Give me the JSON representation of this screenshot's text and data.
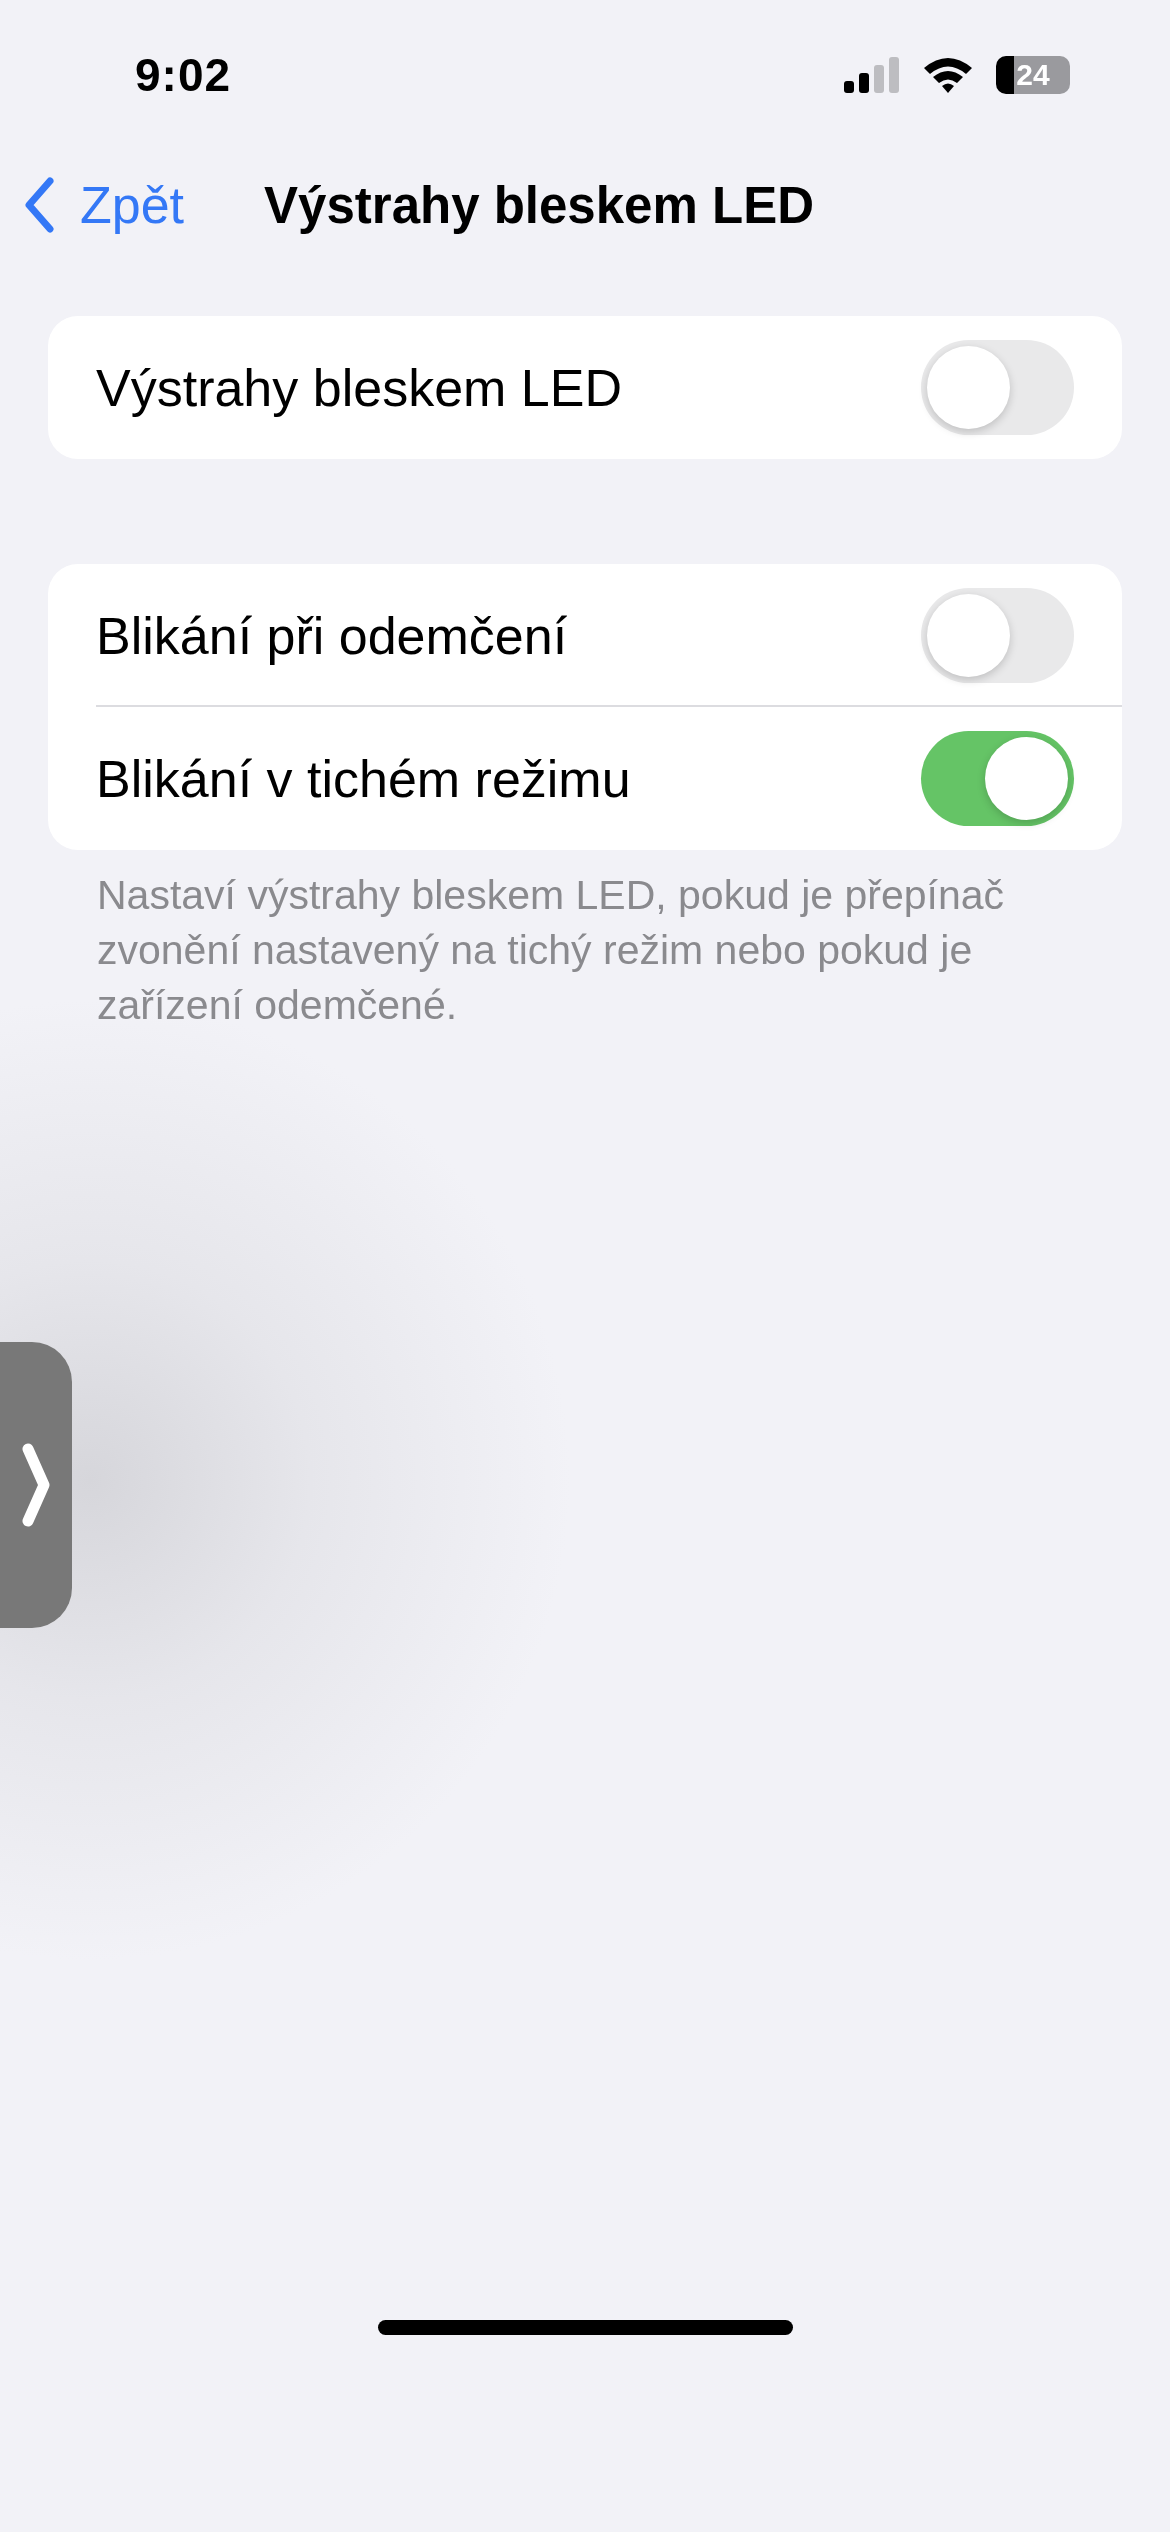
{
  "status_bar": {
    "time": "9:02",
    "battery": "24"
  },
  "nav": {
    "back": "Zpět",
    "title": "Výstrahy bleskem LED"
  },
  "groups": [
    {
      "rows": [
        {
          "label": "Výstrahy bleskem LED",
          "on": false
        }
      ]
    },
    {
      "rows": [
        {
          "label": "Blikání při odemčení",
          "on": false
        },
        {
          "label": "Blikání v tichém režimu",
          "on": true
        }
      ],
      "footer": "Nastaví výstrahy bleskem LED, pokud je přepínač zvonění nastavený na tichý režim nebo pokud je zařízení odemčené."
    }
  ]
}
